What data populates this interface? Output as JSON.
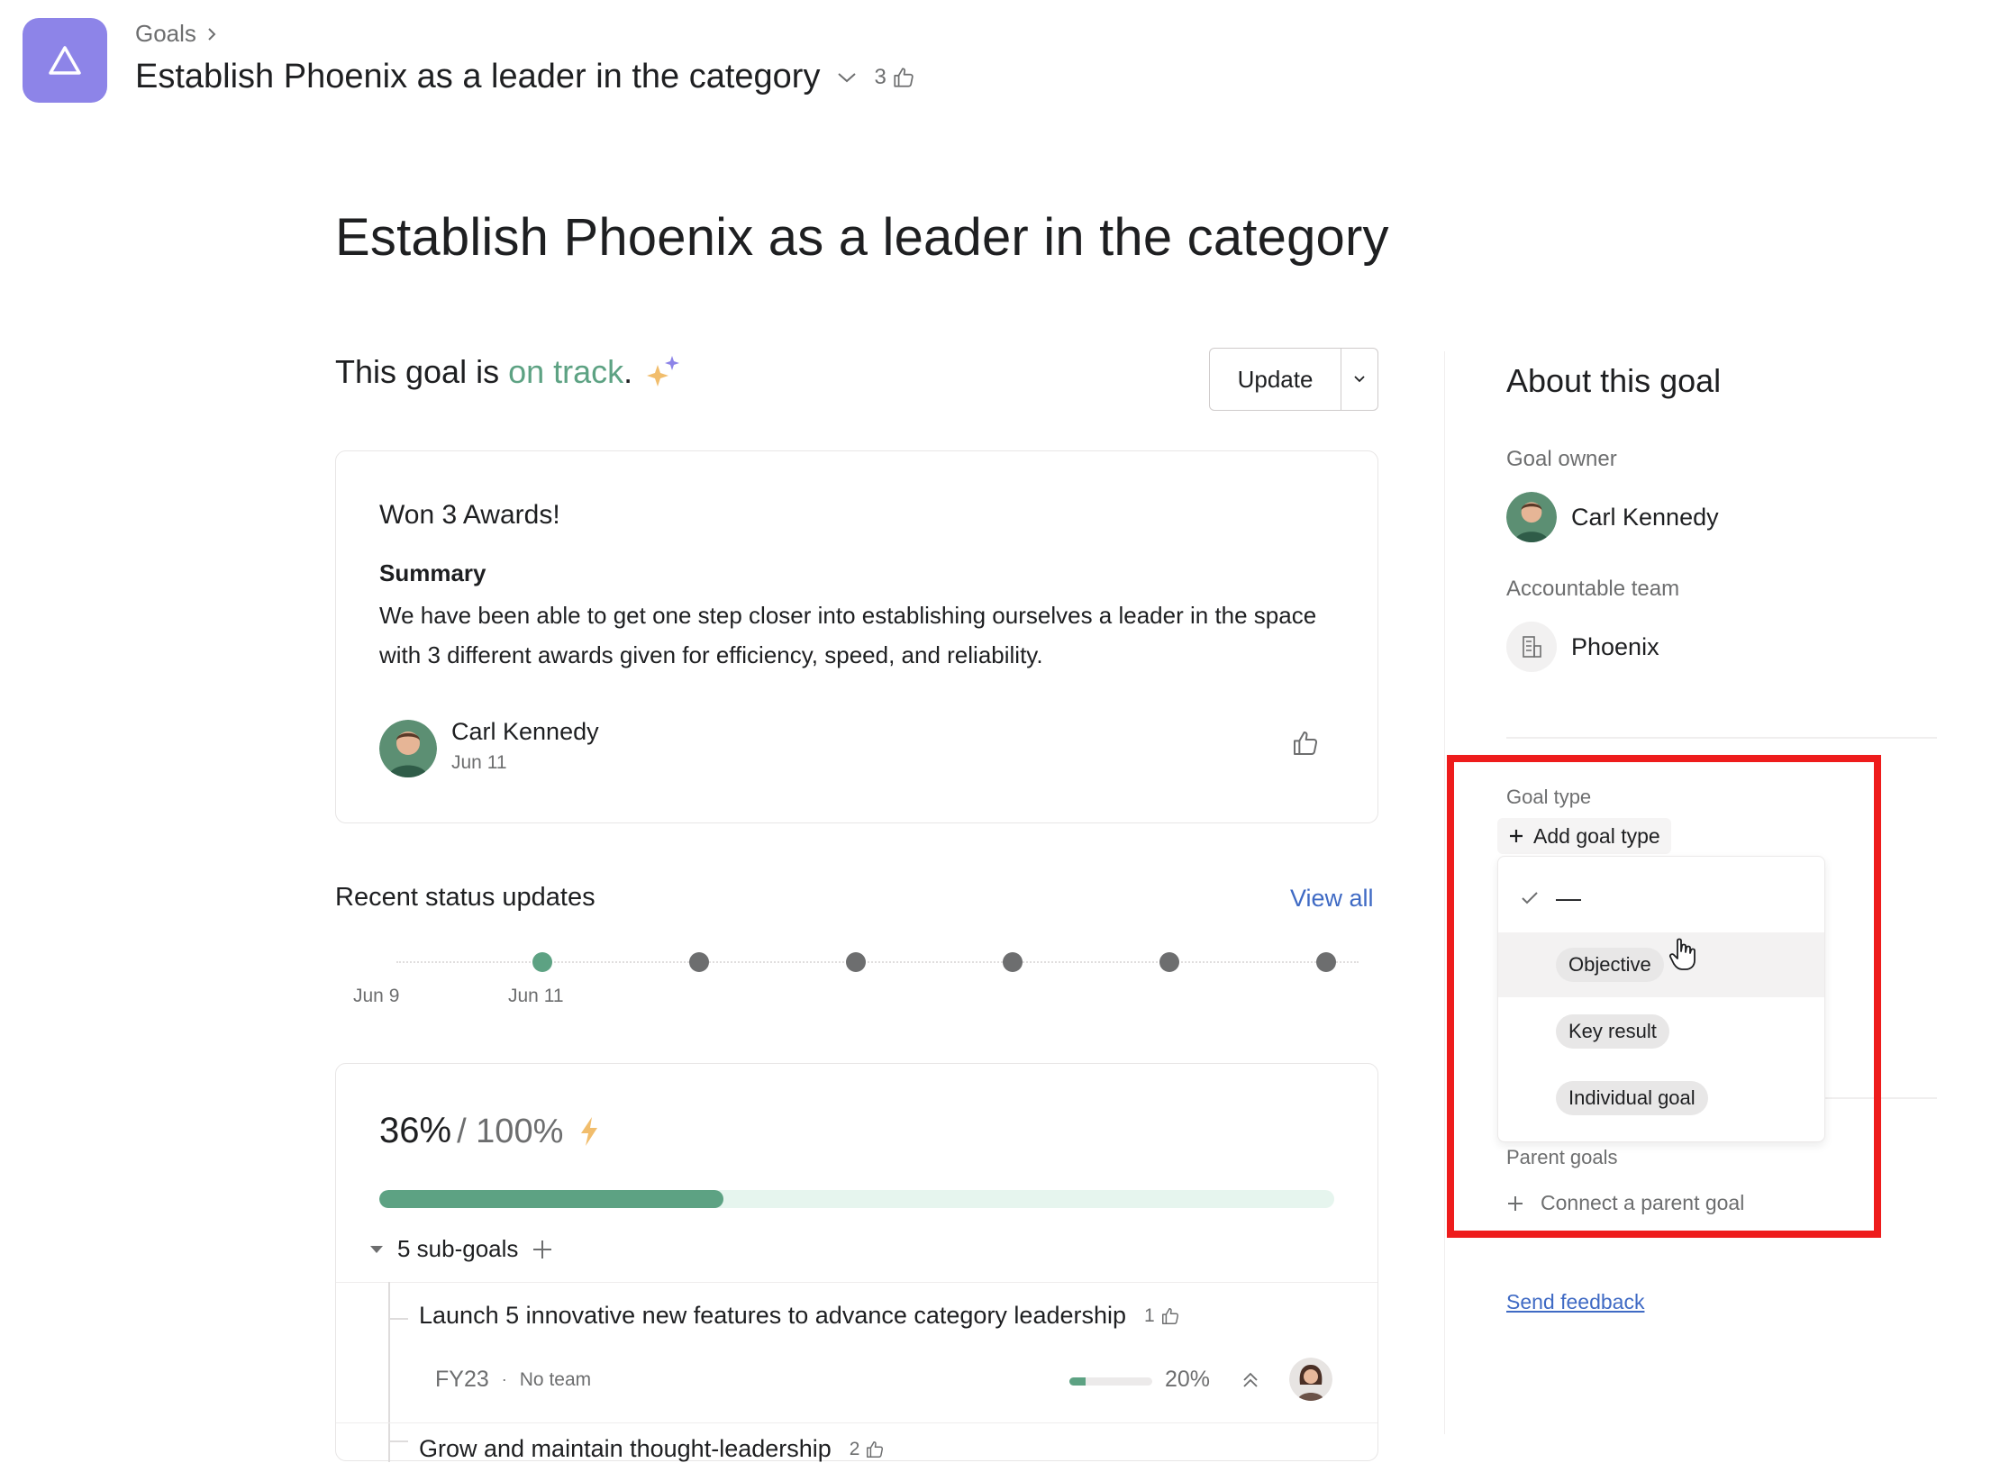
{
  "header": {
    "breadcrumb": "Goals",
    "title": "Establish Phoenix as a leader in the category",
    "like_count": "3"
  },
  "main": {
    "title": "Establish Phoenix as a leader in the category",
    "status_prefix": "This goal is",
    "status_value": "on track",
    "status_suffix": ".",
    "update_button": "Update",
    "status_card": {
      "title": "Won 3 Awards!",
      "summary_heading": "Summary",
      "summary_text": "We have been able to get one step closer into establishing ourselves a leader in the space with 3 different awards given for efficiency, speed, and reliability.",
      "author": "Carl Kennedy",
      "date": "Jun 11"
    },
    "recent_updates": {
      "heading": "Recent status updates",
      "view_all": "View all",
      "labels": [
        "Jun 9",
        "Jun 11"
      ]
    },
    "progress": {
      "current": "36%",
      "total": "/ 100%",
      "fraction": 0.36,
      "subgoals_label": "5 sub-goals",
      "subgoals": [
        {
          "title": "Launch 5 innovative new features to advance category leadership",
          "likes": "1",
          "period": "FY23",
          "separator": "·",
          "team": "No team",
          "percent": "20%",
          "fraction": 0.2
        },
        {
          "title": "Grow and maintain thought-leadership",
          "likes": "2"
        }
      ]
    }
  },
  "sidebar": {
    "heading": "About this goal",
    "owner_label": "Goal owner",
    "owner_name": "Carl Kennedy",
    "team_label": "Accountable team",
    "team_name": "Phoenix",
    "goal_type_label": "Goal type",
    "add_goal_type": "Add goal type",
    "dropdown": {
      "selected": "—",
      "options": [
        "Objective",
        "Key result",
        "Individual goal"
      ]
    },
    "parent_goals_label": "Parent goals",
    "connect_parent": "Connect a parent goal",
    "send_feedback": "Send feedback"
  },
  "colors": {
    "accent_purple": "#8d84e8",
    "on_track_green": "#5da283",
    "link_blue": "#3f6ac4",
    "highlight_red": "#ee1c1c"
  },
  "icons": [
    "triangle-icon",
    "chevron-right-icon",
    "chevron-down-icon",
    "thumbs-up-icon",
    "sparkle-icon",
    "lightning-icon",
    "plus-icon",
    "check-icon",
    "team-building-icon",
    "arrows-up-icon",
    "hand-cursor-icon"
  ]
}
